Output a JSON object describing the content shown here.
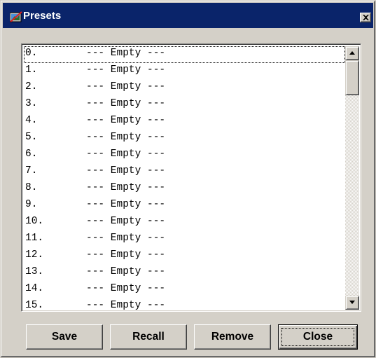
{
  "window": {
    "title": "Presets"
  },
  "icons": {
    "app": "presets-app-icon",
    "close": "close-icon",
    "scroll_up": "arrow-up-icon",
    "scroll_down": "arrow-down-icon"
  },
  "colors": {
    "titlebar": "#0a246a",
    "face": "#d4d0c8",
    "list_background": "#ffffff"
  },
  "presets": {
    "items": [
      {
        "number": "0.",
        "label": "--- Empty ---"
      },
      {
        "number": "1.",
        "label": "--- Empty ---"
      },
      {
        "number": "2.",
        "label": "--- Empty ---"
      },
      {
        "number": "3.",
        "label": "--- Empty ---"
      },
      {
        "number": "4.",
        "label": "--- Empty ---"
      },
      {
        "number": "5.",
        "label": "--- Empty ---"
      },
      {
        "number": "6.",
        "label": "--- Empty ---"
      },
      {
        "number": "7.",
        "label": "--- Empty ---"
      },
      {
        "number": "8.",
        "label": "--- Empty ---"
      },
      {
        "number": "9.",
        "label": "--- Empty ---"
      },
      {
        "number": "10.",
        "label": "--- Empty ---"
      },
      {
        "number": "11.",
        "label": "--- Empty ---"
      },
      {
        "number": "12.",
        "label": "--- Empty ---"
      },
      {
        "number": "13.",
        "label": "--- Empty ---"
      },
      {
        "number": "14.",
        "label": "--- Empty ---"
      },
      {
        "number": "15.",
        "label": "--- Empty ---"
      }
    ]
  },
  "buttons": {
    "save": "Save",
    "recall": "Recall",
    "remove": "Remove",
    "close": "Close"
  }
}
